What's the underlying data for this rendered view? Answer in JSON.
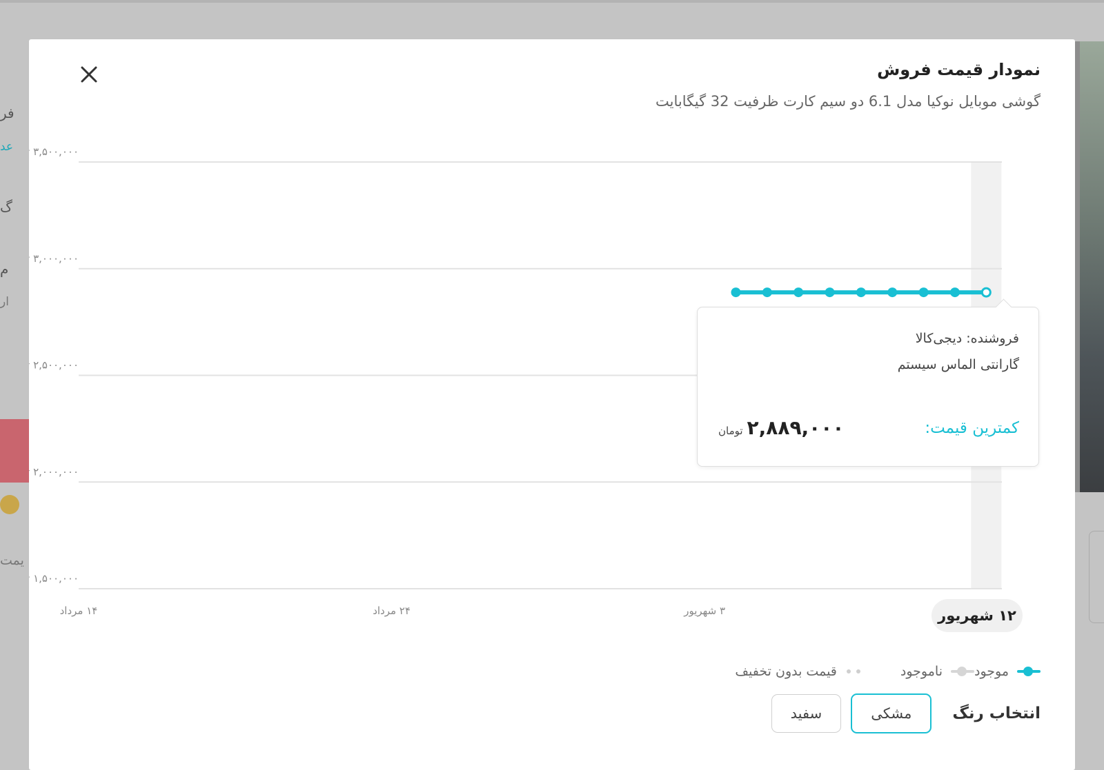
{
  "background": {
    "left_fragments": [
      "فر",
      "عد",
      "گ",
      "م",
      "ار",
      "یمت"
    ]
  },
  "modal": {
    "title": "نمودار قیمت فروش",
    "subtitle": "گوشی موبایل نوکیا مدل 6.1 دو سیم کارت ظرفیت 32 گیگابایت",
    "close_icon": "close-icon"
  },
  "chart_data": {
    "type": "line",
    "y_ticks": [
      {
        "value": 3500000,
        "label": "۳,۵۰۰,۰۰۰ تومان"
      },
      {
        "value": 3000000,
        "label": "۳,۰۰۰,۰۰۰ تومان"
      },
      {
        "value": 2500000,
        "label": "۲,۵۰۰,۰۰۰ تومان"
      },
      {
        "value": 2000000,
        "label": "۲,۰۰۰,۰۰۰ تومان"
      },
      {
        "value": 1500000,
        "label": "۱,۵۰۰,۰۰۰ تومان"
      }
    ],
    "ylim": [
      1500000,
      3500000
    ],
    "x_ticks": [
      {
        "day": 0,
        "label": "۱۴ مرداد"
      },
      {
        "day": 10,
        "label": "۲۴ مرداد"
      },
      {
        "day": 20,
        "label": "۳ شهریور"
      },
      {
        "day": 29,
        "label": "۱۲ شهریور"
      }
    ],
    "xlim": [
      0,
      29.5
    ],
    "series": [
      {
        "name": "موجود",
        "color": "#19bfd3",
        "points": [
          {
            "day": 21,
            "price": 2889000
          },
          {
            "day": 22,
            "price": 2889000
          },
          {
            "day": 23,
            "price": 2889000
          },
          {
            "day": 24,
            "price": 2889000
          },
          {
            "day": 25,
            "price": 2889000
          },
          {
            "day": 26,
            "price": 2889000
          },
          {
            "day": 27,
            "price": 2889000
          },
          {
            "day": 28,
            "price": 2889000
          },
          {
            "day": 29,
            "price": 2889000
          }
        ]
      }
    ],
    "highlighted_day": 29,
    "grid": true
  },
  "tooltip": {
    "seller": "فروشنده: دیجی‌کالا",
    "warranty": "گارانتی الماس سیستم",
    "price_label": "کمترین قیمت:",
    "price_value": "۲,۸۸۹,۰۰۰",
    "price_unit": "تومان"
  },
  "legend": {
    "available": "موجود",
    "unavailable": "ناموجود",
    "no_discount": "قیمت بدون تخفیف"
  },
  "colors": {
    "label": "انتخاب رنگ",
    "options": [
      "مشکی",
      "سفید"
    ],
    "selected": "مشکی",
    "accent": "#19bfd3"
  }
}
